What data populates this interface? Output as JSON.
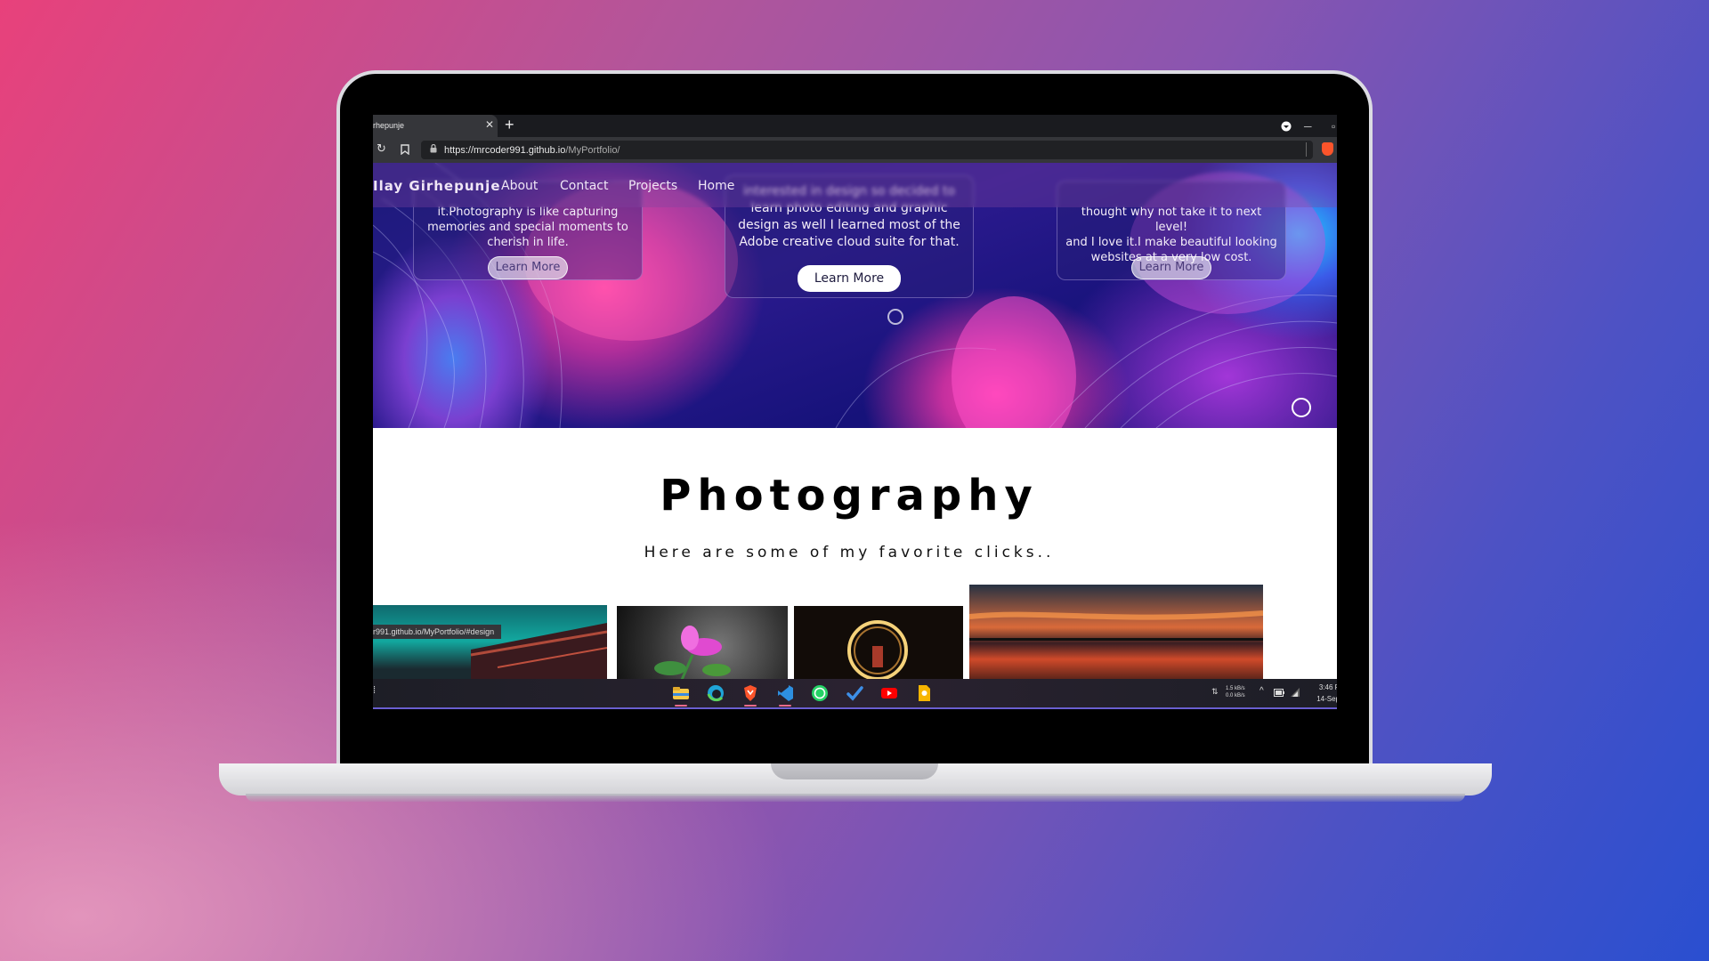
{
  "browser": {
    "tab_title": "rhepunje",
    "tab_close": "✕",
    "new_tab": "+",
    "url_host": "https://mrcoder991.github.io",
    "url_path": "/MyPortfolio/",
    "status_url": "r991.github.io/MyPortfolio/#design"
  },
  "nav": {
    "brand": "Ilay Girhepunje",
    "links": [
      "About",
      "Contact",
      "Projects",
      "Home"
    ]
  },
  "cards": {
    "left": {
      "lines": [
        "it.Photography is like capturing",
        "memories and special moments to",
        "cherish in life."
      ],
      "button": "Learn More"
    },
    "center": {
      "lines": [
        "interested in design so decided to",
        "learn photo editing and graphic",
        "design as well I learned most of the",
        "Adobe creative cloud suite for that."
      ],
      "button": "Learn More"
    },
    "right": {
      "lines": [
        "thought why not take it to next level!",
        "and I love it.I make beautiful looking",
        "websites at a very low cost."
      ],
      "button": "Learn More"
    }
  },
  "photography": {
    "title": "Photography",
    "subtitle": "Here are some of my favorite clicks.."
  },
  "taskbar": {
    "apps": [
      "file-explorer",
      "edge",
      "brave",
      "vscode",
      "whatsapp",
      "todo",
      "youtube",
      "keep"
    ],
    "net_up": "1.5 kB/s",
    "net_down": "0.0 kB/s",
    "time": "3:46 P",
    "date": "14-Sep"
  }
}
